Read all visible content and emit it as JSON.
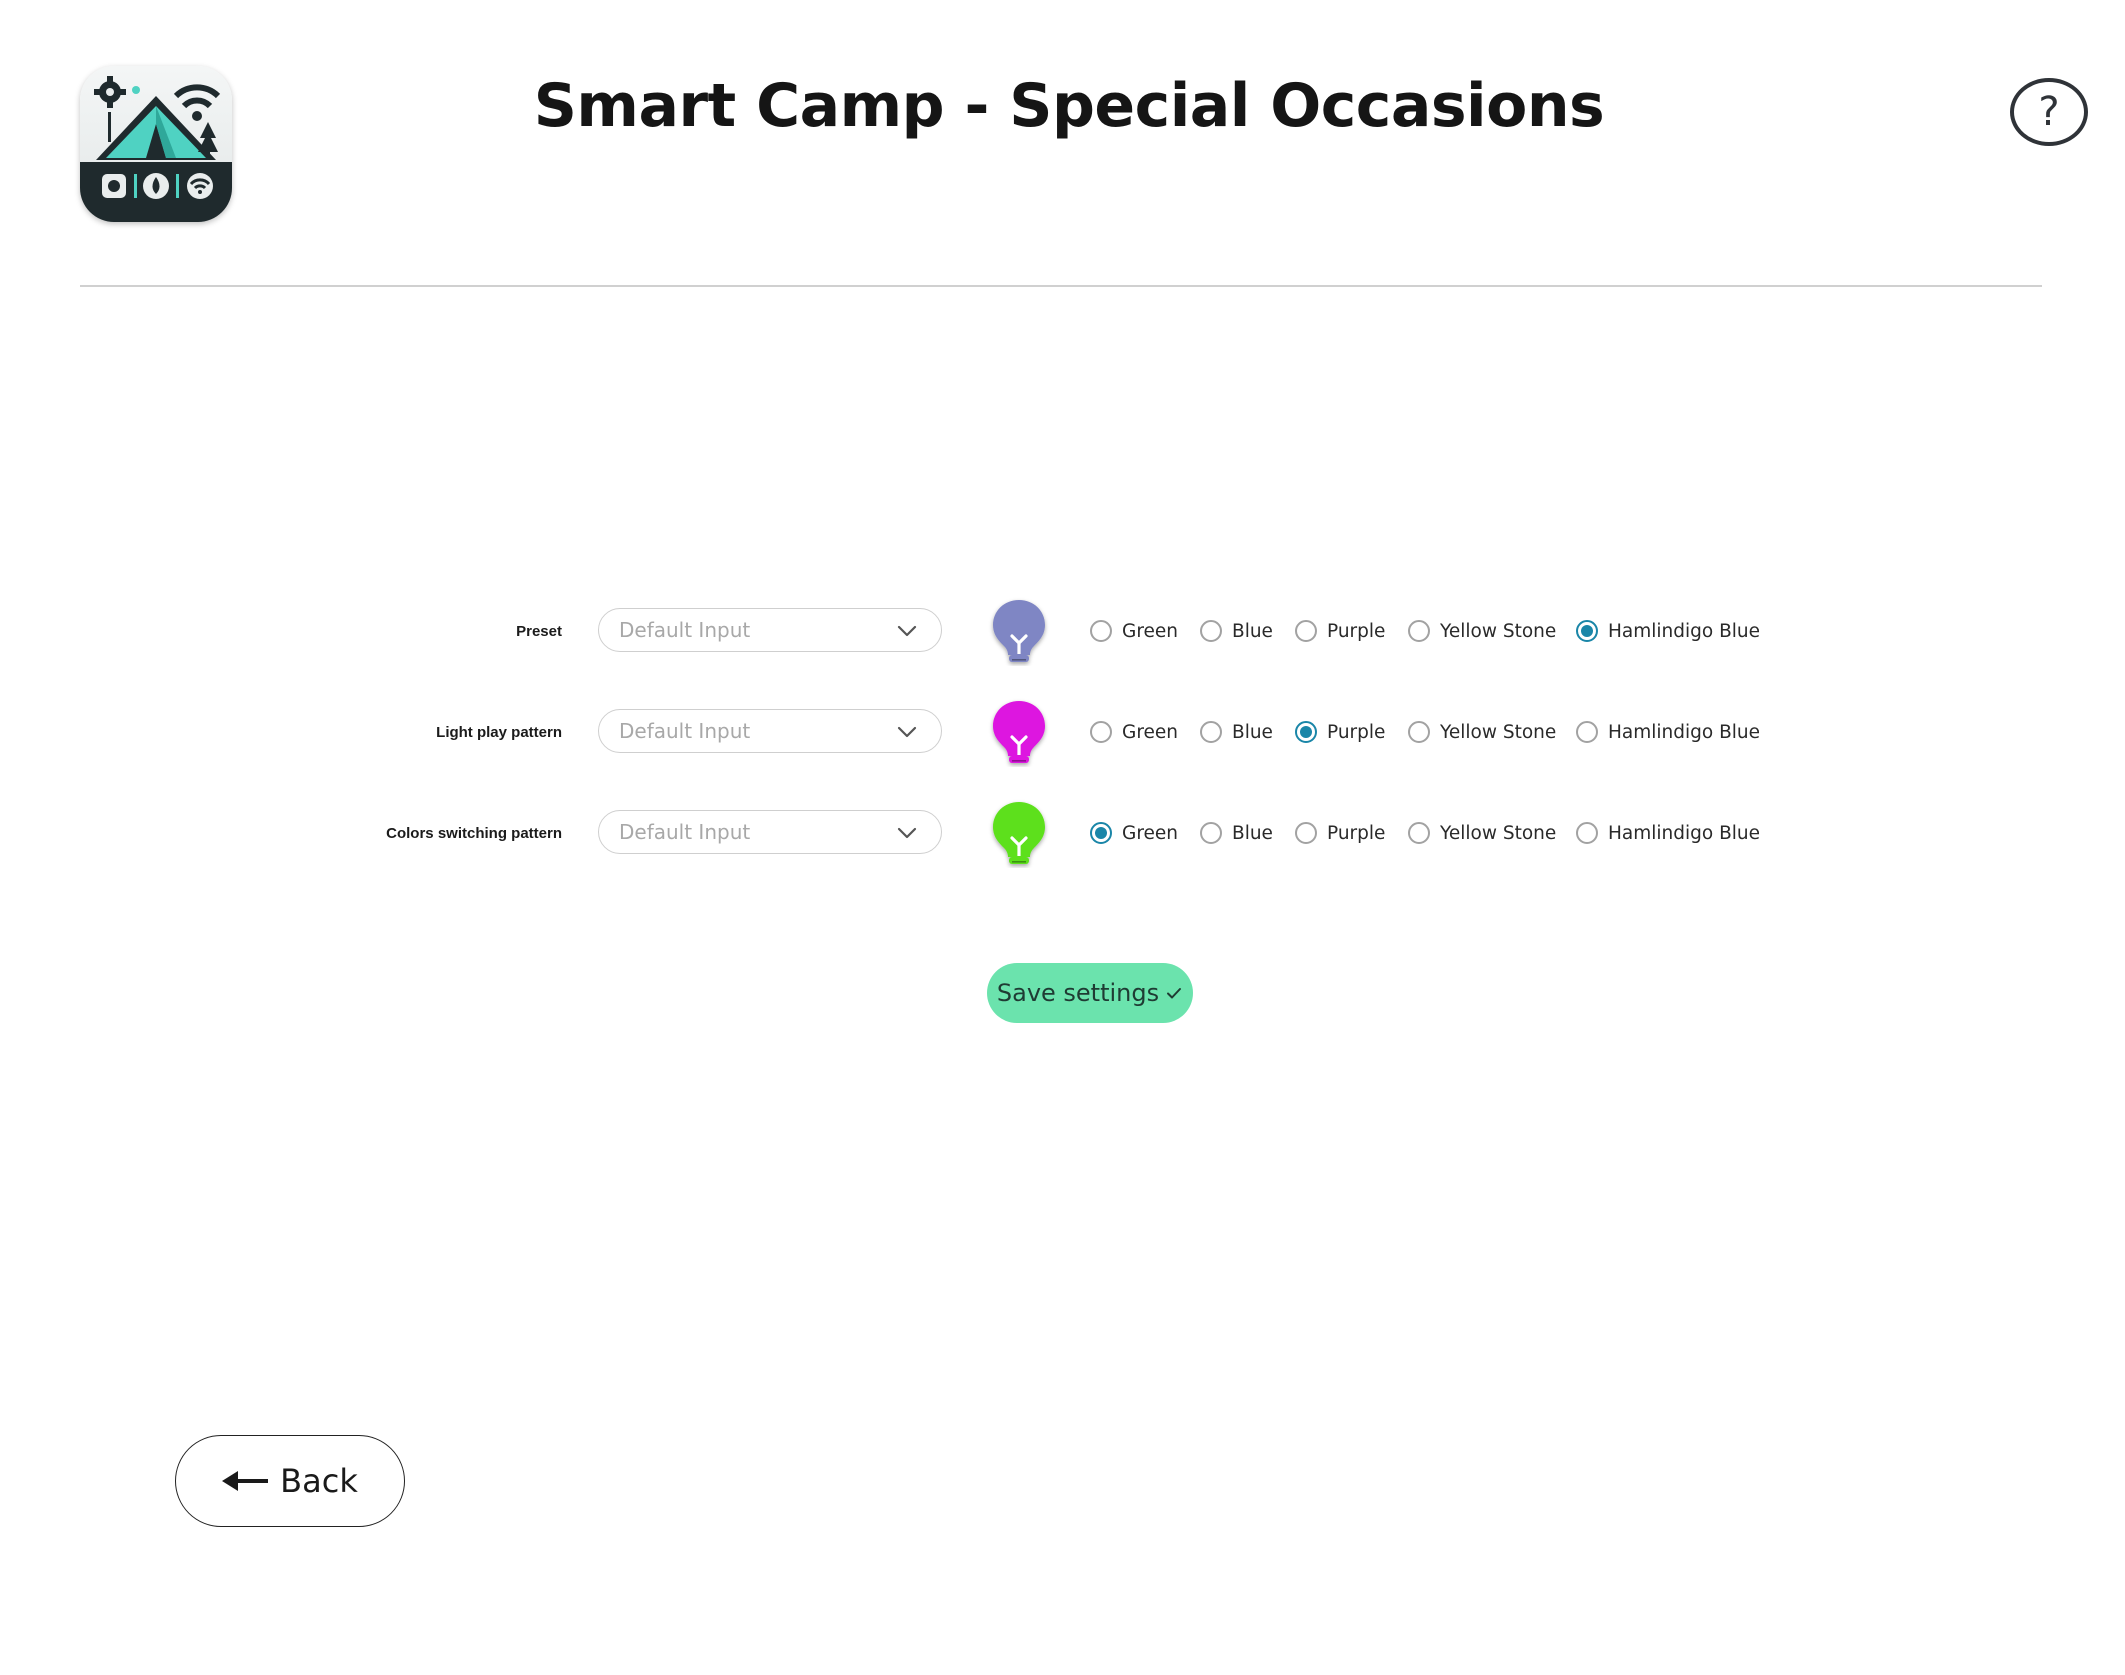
{
  "header": {
    "title": "Smart Camp - Special Occasions",
    "help_label": "?",
    "logo_icon": "smart-camp-tent-logo"
  },
  "settings": [
    {
      "id": "preset",
      "label": "Preset",
      "select_placeholder": "Default Input",
      "bulb_color": "#7f86c4",
      "options": [
        "Green",
        "Blue",
        "Purple",
        "Yellow Stone",
        "Hamlindigo Blue"
      ],
      "selected": "Hamlindigo Blue"
    },
    {
      "id": "light-play-pattern",
      "label": "Light play pattern",
      "select_placeholder": "Default Input",
      "bulb_color": "#dd14e0",
      "options": [
        "Green",
        "Blue",
        "Purple",
        "Yellow Stone",
        "Hamlindigo Blue"
      ],
      "selected": "Purple"
    },
    {
      "id": "colors-switching-pattern",
      "label": "Colors switching pattern",
      "select_placeholder": "Default Input",
      "bulb_color": "#5de01c",
      "options": [
        "Green",
        "Blue",
        "Purple",
        "Yellow Stone",
        "Hamlindigo Blue"
      ],
      "selected": "Green"
    }
  ],
  "save_button": {
    "label": "Save settings",
    "color": "#6be3ad"
  },
  "back_button": {
    "label": "Back"
  },
  "colors": {
    "radio_accent": "#1a86a8"
  }
}
